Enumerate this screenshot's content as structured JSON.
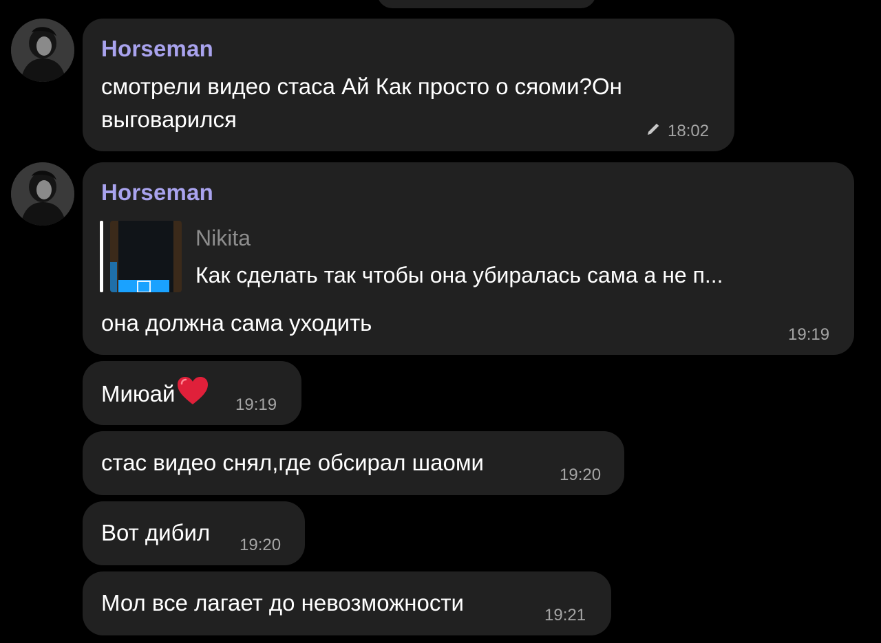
{
  "colors": {
    "background": "#000000",
    "bubble": "#212121",
    "author": "#a9a3ee",
    "time": "#a5a5a5",
    "reply_name": "#8d8d8d",
    "heart": "#e0203a"
  },
  "messages": [
    {
      "author": "Horseman",
      "text_line1": "смотрели видео стаса Ай Как просто о сяоми?Он",
      "text_line2": "выговарился",
      "time": "18:02",
      "edited_icon": "pencil-icon"
    },
    {
      "author": "Horseman",
      "reply": {
        "name": "Nikita",
        "text": "Как сделать так чтобы она убиралась сама а не п..."
      },
      "text": "она должна сама уходить",
      "time": "19:19"
    },
    {
      "text": "Миюай",
      "emoji_icon": "red-heart-icon",
      "time": "19:19"
    },
    {
      "text": "стас видео снял,где обсирал шаоми",
      "time": "19:20"
    },
    {
      "text": "Вот дибил",
      "time": "19:20"
    },
    {
      "text": "Мол все лагает до невозможности",
      "time": "19:21"
    }
  ]
}
